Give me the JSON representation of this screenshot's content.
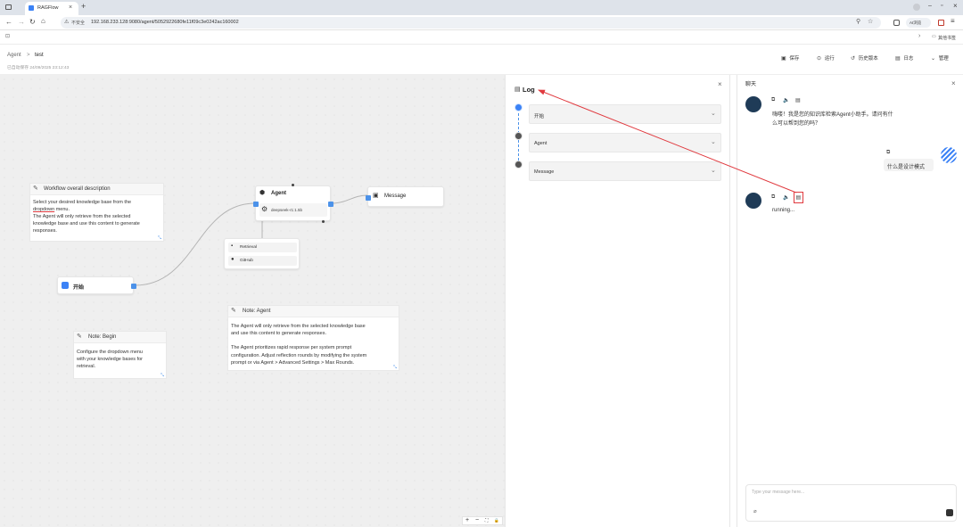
{
  "browser": {
    "tab_title": "RAGFlow",
    "url_warning": "不安全",
    "url": "192.168.233.128:9080/agent/5052922680fe11f09c3e0242ac160002",
    "profile_label": "AI浏览",
    "bookmarks_right": "其他书签"
  },
  "header": {
    "breadcrumb_root": "Agent",
    "breadcrumb_sep": ">",
    "breadcrumb_current": "test",
    "saved_status": "已自动保存 24/09/2025 23:12:43",
    "actions": [
      "保存",
      "运行",
      "历史版本",
      "日志",
      "管理"
    ]
  },
  "canvas": {
    "note_overall": {
      "title": "Workflow overall description",
      "line1": "Select your desired knowledge base from the",
      "line2_link": "dropdown",
      "line2_rest": " menu.",
      "line3": "The Agent will only retrieve from the selected",
      "line4": "knowledge base and use this content  to generate",
      "line5": "responses."
    },
    "begin_node": {
      "label": "开始"
    },
    "agent_node": {
      "title": "Agent",
      "model": "deepseek-r1:1.5b"
    },
    "message_node": {
      "title": "Message"
    },
    "tools": [
      "Retrieval",
      "GitHub"
    ],
    "note_agent": {
      "title": "Note: Agent",
      "lines": [
        "The Agent will only retrieve from the selected knowledge base",
        "and use this content  to generate responses.",
        "",
        "The Agent prioritizes rapid response per system prompt",
        "configuration. Adjust reflection rounds by modifying the system",
        "prompt or via Agent > Advanced Settings > Max Rounds."
      ]
    },
    "note_begin": {
      "title": "Note: Begin",
      "lines": [
        "Configure the dropdown menu",
        "with your knowledge bases for",
        "retrieval."
      ]
    },
    "zoom_controls": [
      "+",
      "−",
      "⛶",
      "🔒"
    ]
  },
  "log": {
    "title": "Log",
    "steps": [
      "开始",
      "Agent",
      "Message"
    ]
  },
  "chat": {
    "title": "聊天",
    "bot_message_1_line1": "嗨喽！我是您的知识库检索Agent小助手。请问有什",
    "bot_message_1_line2": "么可以帮到您的吗？",
    "user_message": "什么是设计模式",
    "bot_message_2": "running...",
    "input_placeholder": "Type your message here..."
  },
  "colors": {
    "accent": "#4c92e9",
    "annotation_red": "#e0393e"
  }
}
